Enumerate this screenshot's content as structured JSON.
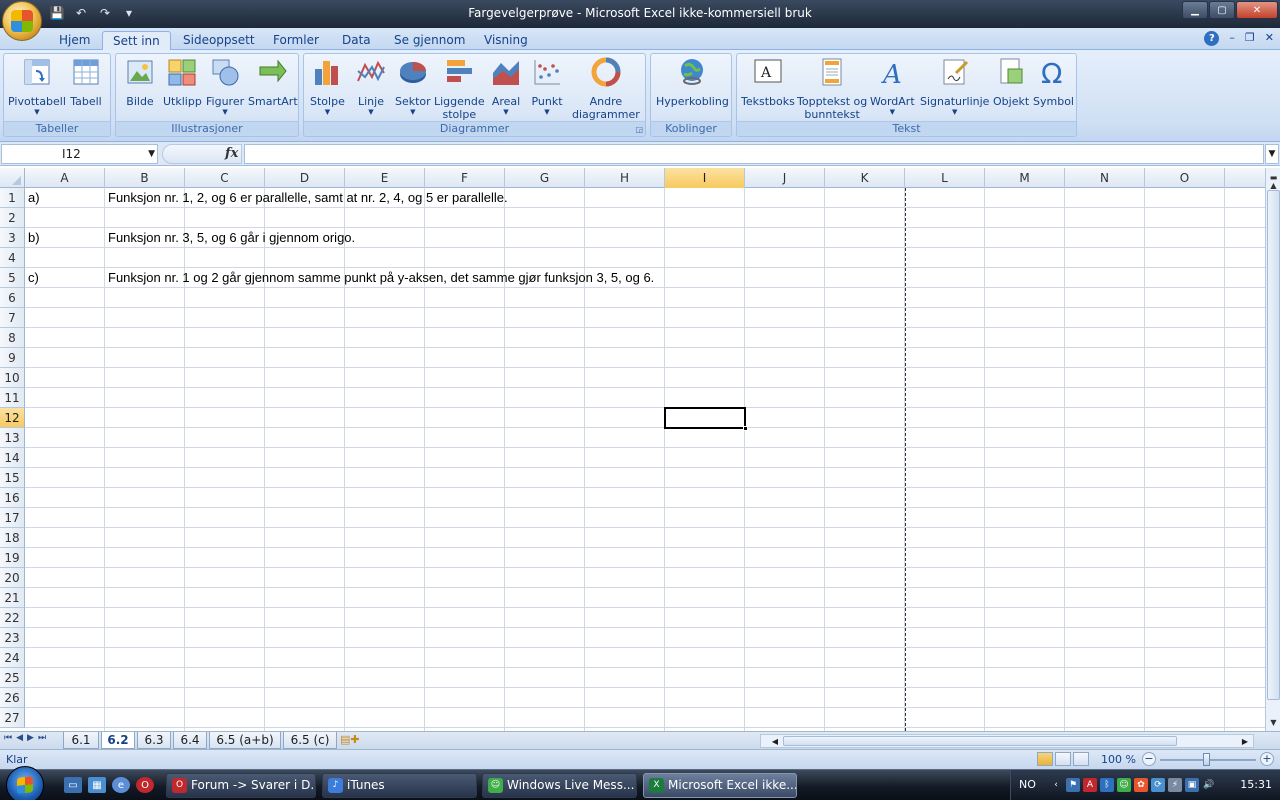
{
  "window": {
    "title": "Fargevelgerprøve - Microsoft Excel ikke-kommersiell bruk",
    "controls": {
      "minimize": "▁",
      "maximize": "▢",
      "close": "✕"
    }
  },
  "qat": {
    "save": "💾",
    "undo": "↶",
    "redo": "↷",
    "customize": "▾"
  },
  "ribbon_tabs": [
    "Hjem",
    "Sett inn",
    "Sideoppsett",
    "Formler",
    "Data",
    "Se gjennom",
    "Visning"
  ],
  "active_tab": "Sett inn",
  "ribbon_right": {
    "help": "?",
    "min": "–",
    "restore": "❐",
    "close": "✕"
  },
  "ribbon": {
    "groups": [
      {
        "label": "Tabeller",
        "buttons": [
          {
            "label": "Pivottabell",
            "icon": "pivottable-icon"
          },
          {
            "label": "Tabell",
            "icon": "table-icon"
          }
        ]
      },
      {
        "label": "Illustrasjoner",
        "buttons": [
          {
            "label": "Bilde",
            "icon": "picture-icon"
          },
          {
            "label": "Utklipp",
            "icon": "clipart-icon"
          },
          {
            "label": "Figurer",
            "icon": "shapes-icon"
          },
          {
            "label": "SmartArt",
            "icon": "smartart-icon"
          }
        ]
      },
      {
        "label": "Diagrammer",
        "buttons": [
          {
            "label": "Stolpe",
            "icon": "column-chart-icon"
          },
          {
            "label": "Linje",
            "icon": "line-chart-icon"
          },
          {
            "label": "Sektor",
            "icon": "pie-chart-icon"
          },
          {
            "label": "Liggende",
            "label2": "stolpe",
            "icon": "bar-chart-icon"
          },
          {
            "label": "Areal",
            "icon": "area-chart-icon"
          },
          {
            "label": "Punkt",
            "icon": "scatter-chart-icon"
          },
          {
            "label": "Andre",
            "label2": "diagrammer",
            "icon": "other-charts-icon"
          }
        ]
      },
      {
        "label": "Koblinger",
        "buttons": [
          {
            "label": "Hyperkobling",
            "icon": "hyperlink-icon"
          }
        ]
      },
      {
        "label": "Tekst",
        "buttons": [
          {
            "label": "Tekstboks",
            "icon": "textbox-icon"
          },
          {
            "label": "Topptekst og",
            "label2": "bunntekst",
            "icon": "header-footer-icon"
          },
          {
            "label": "WordArt",
            "icon": "wordart-icon"
          },
          {
            "label": "Signaturlinje",
            "icon": "signature-icon"
          },
          {
            "label": "Objekt",
            "icon": "object-icon"
          },
          {
            "label": "Symbol",
            "icon": "symbol-icon"
          }
        ]
      }
    ]
  },
  "formula_bar": {
    "name_box": "I12",
    "fx": "fx",
    "value": ""
  },
  "columns": [
    "A",
    "B",
    "C",
    "D",
    "E",
    "F",
    "G",
    "H",
    "I",
    "J",
    "K",
    "L",
    "M",
    "N",
    "O"
  ],
  "selected_column": "I",
  "rows": [
    "1",
    "2",
    "3",
    "4",
    "5",
    "6",
    "7",
    "8",
    "9",
    "10",
    "11",
    "12",
    "13",
    "14",
    "15",
    "16",
    "17",
    "18",
    "19",
    "20",
    "21",
    "22",
    "23",
    "24",
    "25",
    "26",
    "27"
  ],
  "selected_row": "12",
  "cells": {
    "A1": "a)",
    "B1": "Funksjon nr. 1, 2, og 6 er parallelle, samt at nr. 2, 4, og 5 er parallelle.",
    "A3": "b)",
    "B3": "Funksjon nr. 3, 5, og 6 går i gjennom origo.",
    "A5": "c)",
    "B5": "Funksjon nr. 1 og 2 går gjennom samme punkt på y-aksen, det samme gjør funksjon 3, 5, og 6."
  },
  "sheet_tabs": [
    "6.1",
    "6.2",
    "6.3",
    "6.4",
    "6.5 (a+b)",
    "6.5 (c)"
  ],
  "active_sheet": "6.2",
  "status": {
    "ready": "Klar",
    "zoom": "100 %"
  },
  "taskbar": {
    "tasks": [
      {
        "label": "Forum -> Svarer i D...",
        "icon": "opera-icon",
        "color": "#c0282d"
      },
      {
        "label": "iTunes",
        "icon": "itunes-icon",
        "color": "#3b7dd8"
      },
      {
        "label": "Windows Live Mess...",
        "icon": "messenger-icon",
        "color": "#3fae49"
      },
      {
        "label": "Microsoft Excel ikke...",
        "icon": "excel-icon",
        "color": "#1e7b3e"
      }
    ],
    "language": "NO",
    "clock": "15:31"
  }
}
